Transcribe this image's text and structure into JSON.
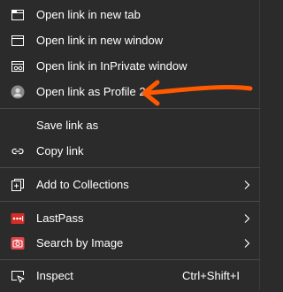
{
  "menu": {
    "items": [
      {
        "label": "Open link in new tab",
        "icon": "new-tab-icon"
      },
      {
        "label": "Open link in new window",
        "icon": "new-window-icon"
      },
      {
        "label": "Open link in InPrivate window",
        "icon": "inprivate-window-icon"
      },
      {
        "label": "Open link as Profile 2",
        "icon": "profile-avatar-icon"
      },
      {
        "label": "Save link as",
        "icon": ""
      },
      {
        "label": "Copy link",
        "icon": "link-icon"
      },
      {
        "label": "Add to Collections",
        "icon": "collections-icon"
      },
      {
        "label": "LastPass",
        "icon": "lastpass-icon"
      },
      {
        "label": "Search by Image",
        "icon": "camera-icon"
      },
      {
        "label": "Inspect",
        "icon": "inspect-icon",
        "shortcut": "Ctrl+Shift+I"
      }
    ]
  },
  "colors": {
    "background": "#2b2b2b",
    "text": "#ffffff",
    "separator": "#4a4a4a",
    "annotation_arrow": "#ff5a00",
    "lastpass_red": "#d32d27",
    "search_image_red": "#e2454b"
  }
}
